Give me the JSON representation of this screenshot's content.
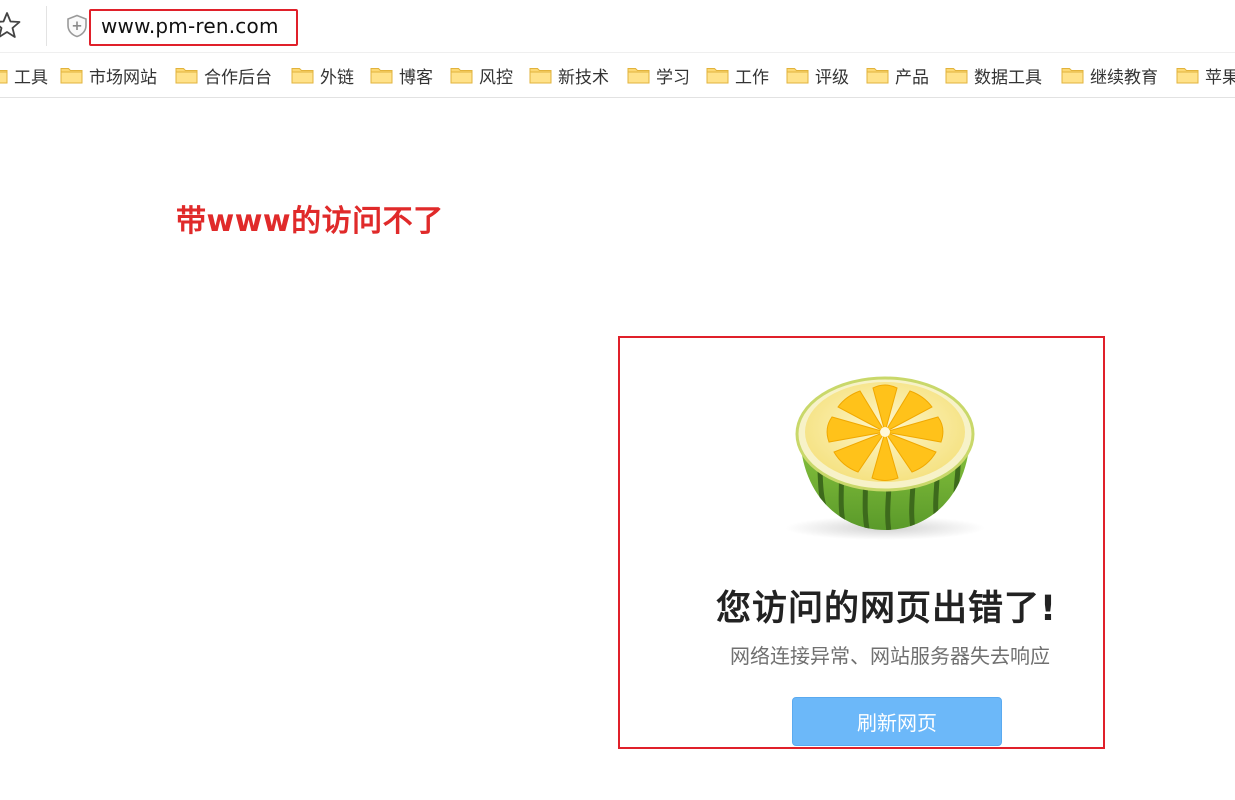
{
  "address_bar": {
    "url": "www.pm-ren.com"
  },
  "bookmarks": [
    {
      "label": "工具"
    },
    {
      "label": "市场网站"
    },
    {
      "label": "合作后台"
    },
    {
      "label": "外链"
    },
    {
      "label": "博客"
    },
    {
      "label": "风控"
    },
    {
      "label": "新技术"
    },
    {
      "label": "学习"
    },
    {
      "label": "工作"
    },
    {
      "label": "评级"
    },
    {
      "label": "产品"
    },
    {
      "label": "数据工具"
    },
    {
      "label": "继续教育"
    },
    {
      "label": "苹果"
    }
  ],
  "annotation": {
    "text": "带www的访问不了",
    "color": "#e02a2a"
  },
  "error_page": {
    "title": "您访问的网页出错了!",
    "subtitle": "网络连接异常、网站服务器失去响应",
    "refresh_label": "刷新网页",
    "button_color": "#6cb8f9",
    "highlight_color": "#e0202a"
  },
  "icons": [
    "star-icon",
    "shield-icon",
    "folder-icon",
    "melon-illustration"
  ]
}
